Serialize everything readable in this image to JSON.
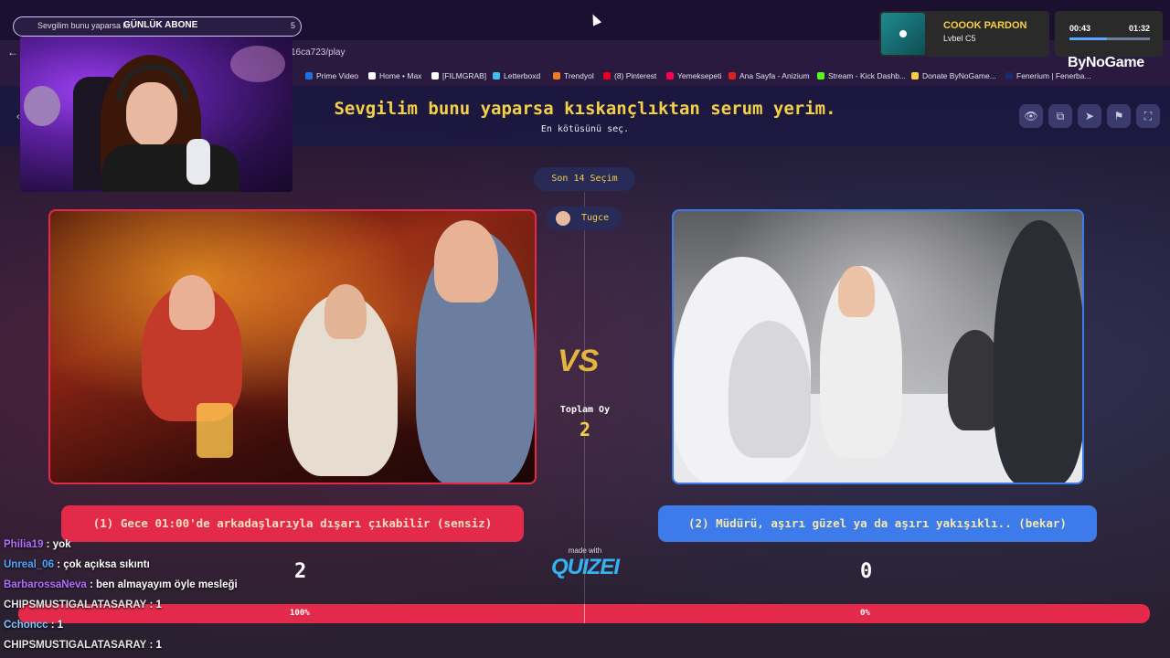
{
  "browser": {
    "tab_count": "0",
    "tab_title": "Sevgilim bunu yaparsa k...",
    "stream_label": "GÜNLÜK ABONE",
    "stream_count": "5",
    "url": "16ca723/play",
    "bookmarks": [
      {
        "label": "Prime Video",
        "color": "#1f6fe0"
      },
      {
        "label": "Home • Max",
        "color": "#ffffff"
      },
      {
        "label": "[FILMGRAB]",
        "color": "#ffffff"
      },
      {
        "label": "Letterboxd",
        "color": "#40bcf4"
      },
      {
        "label": "Trendyol",
        "color": "#f27a1a"
      },
      {
        "label": "(8) Pinterest",
        "color": "#e60023"
      },
      {
        "label": "Yemeksepeti",
        "color": "#fa0050"
      },
      {
        "label": "Ana Sayfa - Anizium",
        "color": "#e02020"
      },
      {
        "label": "Stream - Kick Dashb...",
        "color": "#53fc18"
      },
      {
        "label": "Donate ByNoGame...",
        "color": "#f4d046"
      },
      {
        "label": "Fenerium | Fenerba...",
        "color": "#1b2a6b"
      }
    ]
  },
  "quiz": {
    "title": "Sevgilim bunu yaparsa kıskançlıktan serum yerim.",
    "subtitle": "En kötüsünü seç.",
    "last_choices": "Son 14 Seçim",
    "user": "Tugce",
    "total_votes_label": "Toplam Oy",
    "total_votes": "2",
    "made_with": "made with",
    "brand": "QUIZEI",
    "options": [
      {
        "label": "(1) Gece 01:00'de arkadaşlarıyla dışarı çıkabilir (sensiz)",
        "votes": "2",
        "percent": "100%"
      },
      {
        "label": "(2) Müdürü, aşırı güzel ya da aşırı yakışıklı.. (bekar)",
        "votes": "0",
        "percent": "0%"
      }
    ],
    "accent_left": "#e42a4a",
    "accent_right": "#3e7bea"
  },
  "music": {
    "title": "COOOK PARDON",
    "artist": "Lvbel C5",
    "current": "00:43",
    "total": "01:32",
    "progress": 0.47
  },
  "logo": "ByNoGame",
  "chat": [
    {
      "user": "Philia19",
      "text": ": yok",
      "color": "#b26dff"
    },
    {
      "user": "Unreal_06",
      "text": ": çok açıksa sıkıntı",
      "color": "#4aa8ff"
    },
    {
      "user": "BarbarossaNeva",
      "text": ": ben almayayım öyle mesleği",
      "color": "#b26dff"
    },
    {
      "user": "CHIPSMUSTIGALATASARAY",
      "text": ": 1",
      "color": "#e6e6e6"
    },
    {
      "user": "Cchoncc",
      "text": ": 1",
      "color": "#7ec8ff"
    },
    {
      "user": "CHIPSMUSTIGALATASARAY",
      "text": ": 1",
      "color": "#e6e6e6"
    }
  ]
}
